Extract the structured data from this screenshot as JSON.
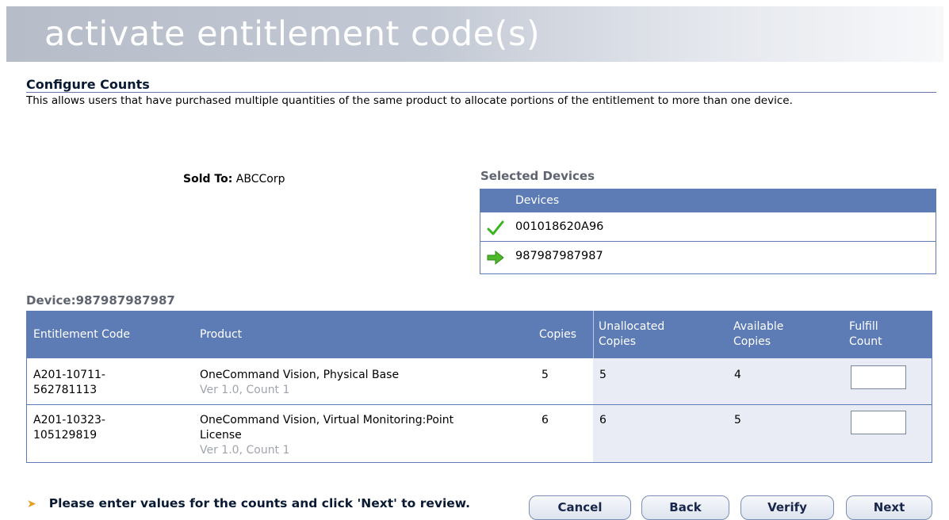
{
  "banner": {
    "title": "activate entitlement code(s)"
  },
  "section": {
    "title": "Configure Counts",
    "description": "This allows users that have purchased multiple quantities of the same product to allocate portions of the entitlement to more than one device."
  },
  "sold_to": {
    "label": "Sold To:",
    "value": "ABCCorp"
  },
  "selected_devices": {
    "title": "Selected Devices",
    "column_header": "Devices",
    "rows": [
      {
        "status_icon": "check-icon",
        "device_id": "001018620A96"
      },
      {
        "status_icon": "arrow-right-icon",
        "device_id": "987987987987"
      }
    ]
  },
  "device_label": "Device:987987987987",
  "entitlements": {
    "headers": {
      "code": "Entitlement Code",
      "product": "Product",
      "copies": "Copies",
      "unallocated_1": "Unallocated",
      "unallocated_2": "Copies",
      "available_1": "Available",
      "available_2": "Copies",
      "fulfill_1": "Fulfill",
      "fulfill_2": "Count"
    },
    "rows": [
      {
        "code_1": "A201-10711-",
        "code_2": "562781113",
        "product_1": "OneCommand Vision, Physical Base",
        "product_2": "",
        "version": "Ver 1.0, Count 1",
        "copies": "5",
        "unallocated": "5",
        "available": "4",
        "fulfill_count": ""
      },
      {
        "code_1": "A201-10323-",
        "code_2": "105129819",
        "product_1": "OneCommand Vision, Virtual Monitoring:Point",
        "product_2": "License",
        "version": "Ver 1.0, Count 1",
        "copies": "6",
        "unallocated": "6",
        "available": "5",
        "fulfill_count": ""
      }
    ]
  },
  "footer": {
    "message": "Please enter values for the counts and click 'Next' to review.",
    "buttons": {
      "cancel": "Cancel",
      "back": "Back",
      "verify": "Verify",
      "next": "Next"
    }
  },
  "colors": {
    "header_blue": "#5d7cb6",
    "shade": "#e9ecf4",
    "accent_orange": "#e3a023",
    "check_green": "#37b51e"
  }
}
